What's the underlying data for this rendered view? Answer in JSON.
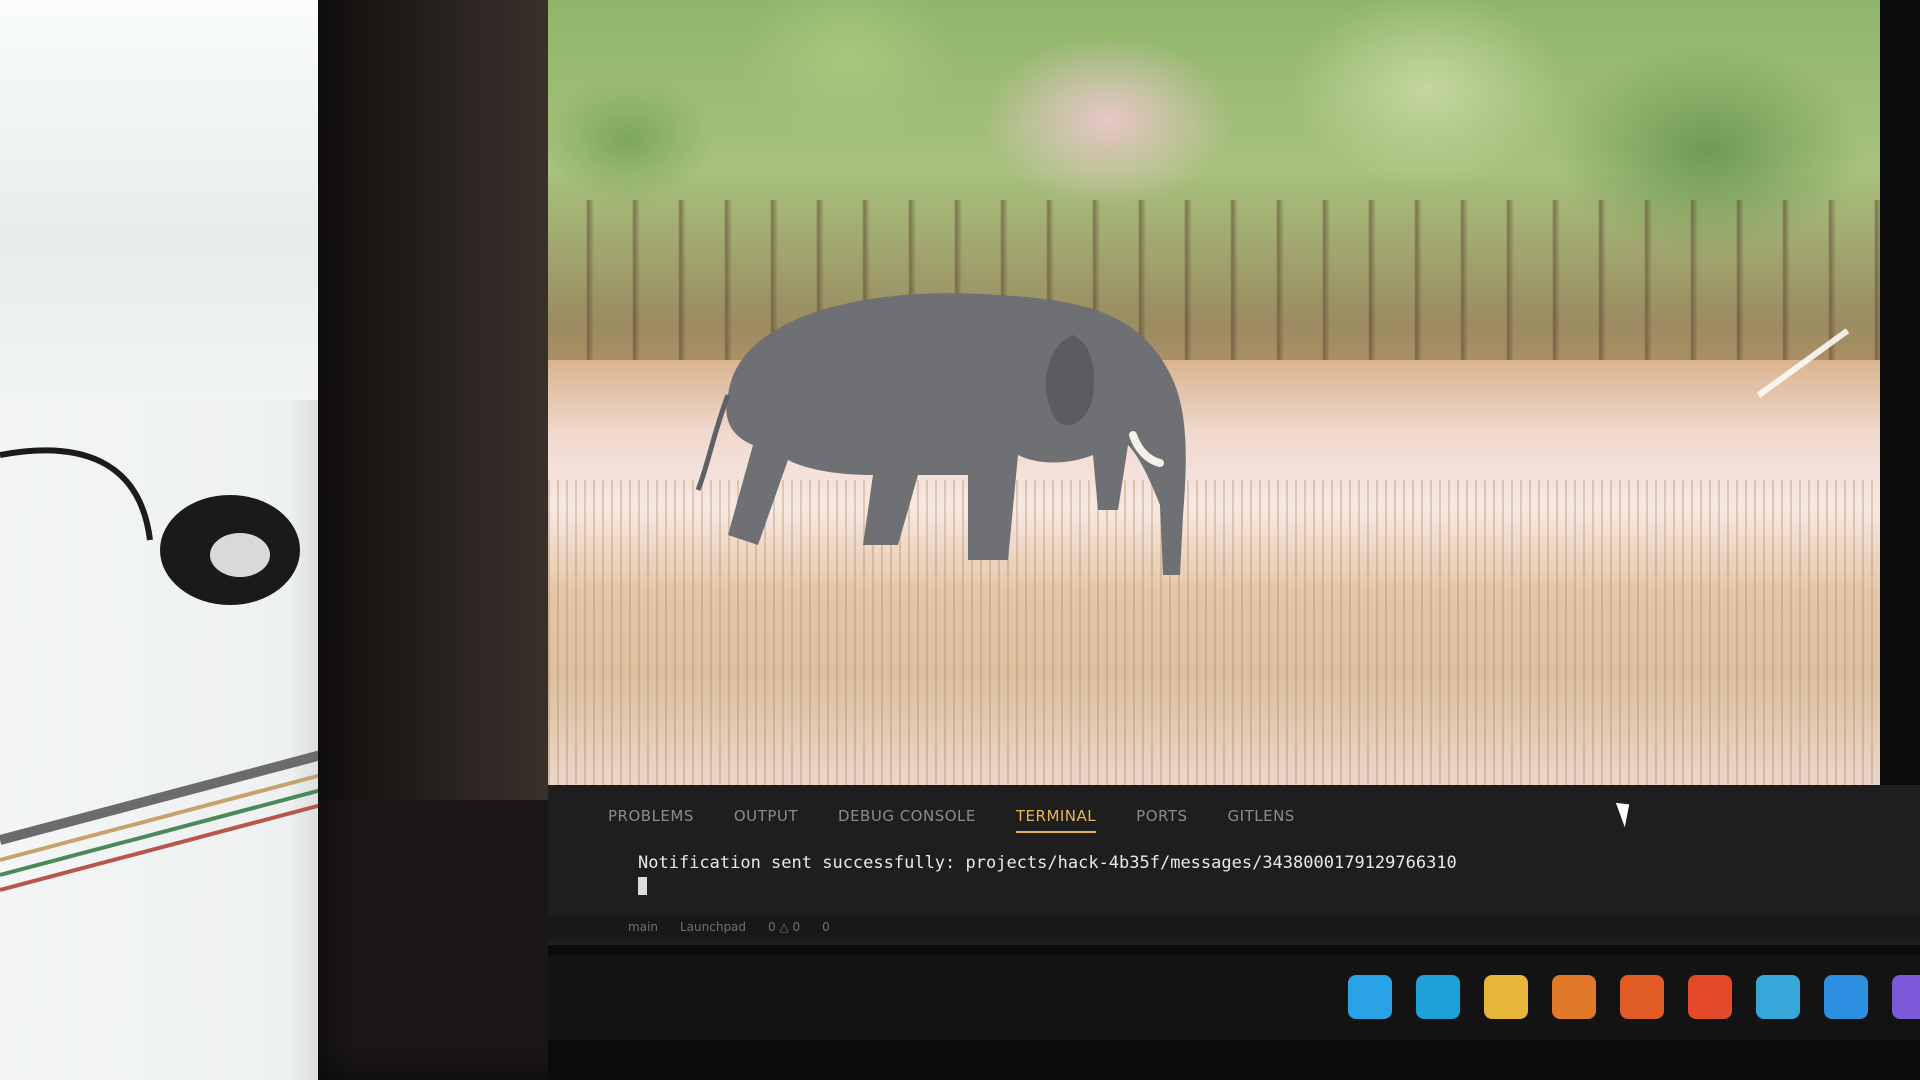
{
  "photo": {
    "subject": "Asian elephant walking through dry grass",
    "colors": {
      "grass": "#ead6ca",
      "trees": "#8fb56a",
      "elephant": "#6f7073"
    }
  },
  "panel": {
    "tabs": [
      {
        "label": "PROBLEMS",
        "active": false
      },
      {
        "label": "OUTPUT",
        "active": false
      },
      {
        "label": "DEBUG CONSOLE",
        "active": false
      },
      {
        "label": "TERMINAL",
        "active": true
      },
      {
        "label": "PORTS",
        "active": false
      },
      {
        "label": "GITLENS",
        "active": false
      }
    ],
    "terminal_line": "Notification sent successfully: projects/hack-4b35f/messages/3438000179129766310"
  },
  "statusbar": {
    "items": [
      "main",
      "Launchpad",
      "0 △ 0",
      "0"
    ]
  },
  "taskbar": {
    "icons": [
      {
        "name": "windows-start-icon",
        "color": "#29a3e6"
      },
      {
        "name": "edge-browser-icon",
        "color": "#1ea0d8"
      },
      {
        "name": "file-explorer-icon",
        "color": "#e8b53b"
      },
      {
        "name": "app-icon",
        "color": "#e07a2a"
      },
      {
        "name": "firefox-icon",
        "color": "#e05b26"
      },
      {
        "name": "brave-icon",
        "color": "#e24a2a"
      },
      {
        "name": "store-icon",
        "color": "#35a7d9"
      },
      {
        "name": "vscode-icon",
        "color": "#2d8fe0"
      },
      {
        "name": "chrome-profile-icon",
        "color": "#7b59d8"
      }
    ]
  }
}
